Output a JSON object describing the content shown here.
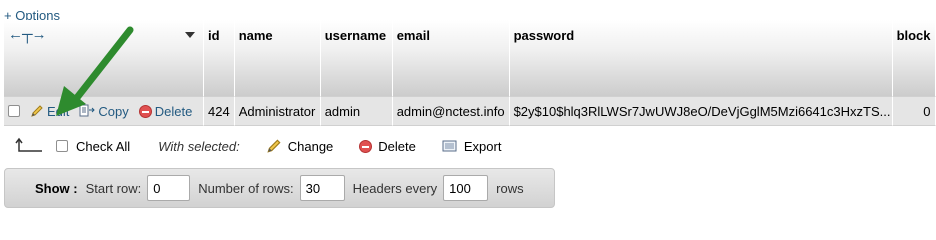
{
  "options_link": "+ Options",
  "table": {
    "columns": [
      {
        "label": "id",
        "width": 30
      },
      {
        "label": "name",
        "width": 86
      },
      {
        "label": "username",
        "width": 72
      },
      {
        "label": "email",
        "width": 116
      },
      {
        "label": "password",
        "width": 383
      },
      {
        "label": "block",
        "width": 42
      }
    ],
    "row": {
      "edit": "Edit",
      "copy": "Copy",
      "delete": "Delete",
      "cells": [
        "424",
        "Administrator",
        "admin",
        "admin@nctest.info",
        "$2y$10$hlq3RlLWSr7JwUWJ8eO/DeVjGglM5Mzi6641c3HxzTS...",
        "0"
      ]
    }
  },
  "with_selected": {
    "check_all": "Check All",
    "label": "With selected:",
    "change": "Change",
    "delete": "Delete",
    "export": "Export"
  },
  "show_bar": {
    "show": "Show :",
    "start_row_label": "Start row:",
    "start_row": "0",
    "num_rows_label": "Number of rows:",
    "num_rows": "30",
    "headers_every_label": "Headers every",
    "headers_every": "100",
    "rows": "rows"
  },
  "colors": {
    "link": "#235a81",
    "arrow": "#2e8b2e",
    "delete": "#e05050"
  }
}
